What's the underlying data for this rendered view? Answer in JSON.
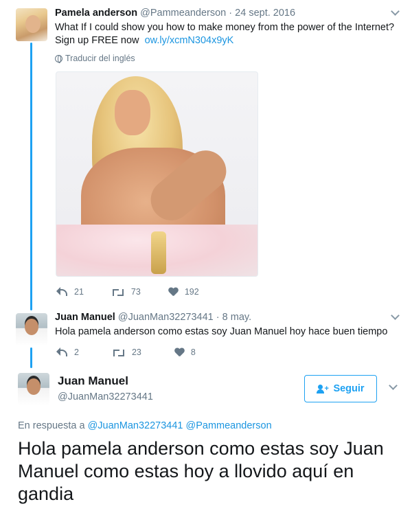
{
  "tweet1": {
    "name": "Pamela anderson",
    "handle": "@Pammeanderson",
    "separator": "·",
    "date": "24 sept. 2016",
    "text_line1": "What If I could show you how to make money from the power of the Internet?",
    "text_line2": "Sign up FREE now",
    "link": "ow.ly/xcmN304x9yK",
    "translate": "Traducir del inglés",
    "replies": "21",
    "retweets": "73",
    "likes": "192"
  },
  "tweet2": {
    "name": "Juan Manuel",
    "handle": "@JuanMan32273441",
    "separator": "·",
    "date": "8 may.",
    "text": "Hola pamela anderson como estas soy Juan Manuel hoy hace buen tiempo",
    "replies": "2",
    "retweets": "23",
    "likes": "8"
  },
  "main": {
    "name": "Juan Manuel",
    "handle": "@JuanMan32273441",
    "follow_label": "Seguir",
    "reply_prefix": "En respuesta a",
    "reply_user1": "@JuanMan32273441",
    "reply_user2": "@Pammeanderson",
    "text": "Hola pamela anderson como estas soy Juan Manuel como estas hoy a llovido aquí en gandia"
  },
  "icons": {
    "reply": "reply-icon",
    "retweet": "retweet-icon",
    "like": "heart-icon",
    "caret": "chevron-down-icon",
    "follow": "add-user-icon",
    "translate": "globe-icon"
  },
  "colors": {
    "accent": "#1da1f2",
    "link": "#1b95e0",
    "muted": "#657786",
    "text": "#14171a"
  }
}
